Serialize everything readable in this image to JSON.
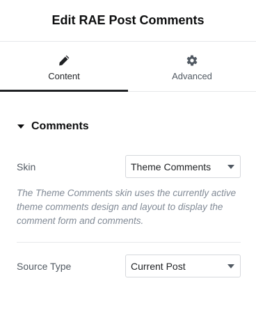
{
  "header": {
    "title": "Edit RAE Post Comments"
  },
  "tabs": [
    {
      "label": "Content",
      "icon": "pencil-icon",
      "active": true
    },
    {
      "label": "Advanced",
      "icon": "gear-icon",
      "active": false
    }
  ],
  "section": {
    "title": "Comments",
    "icon": "caret-down-icon"
  },
  "controls": {
    "skin": {
      "label": "Skin",
      "value": "Theme Comments",
      "description": "The Theme Comments skin uses the currently active theme comments design and layout to display the comment form and comments."
    },
    "source_type": {
      "label": "Source Type",
      "value": "Current Post"
    }
  },
  "colors": {
    "text_dark": "#0c0d0e",
    "text_muted": "#515962",
    "description": "#818a96",
    "border": "#d5d8dc",
    "divider": "#e6e8ea",
    "active_tab_indicator": "#1f2124"
  }
}
